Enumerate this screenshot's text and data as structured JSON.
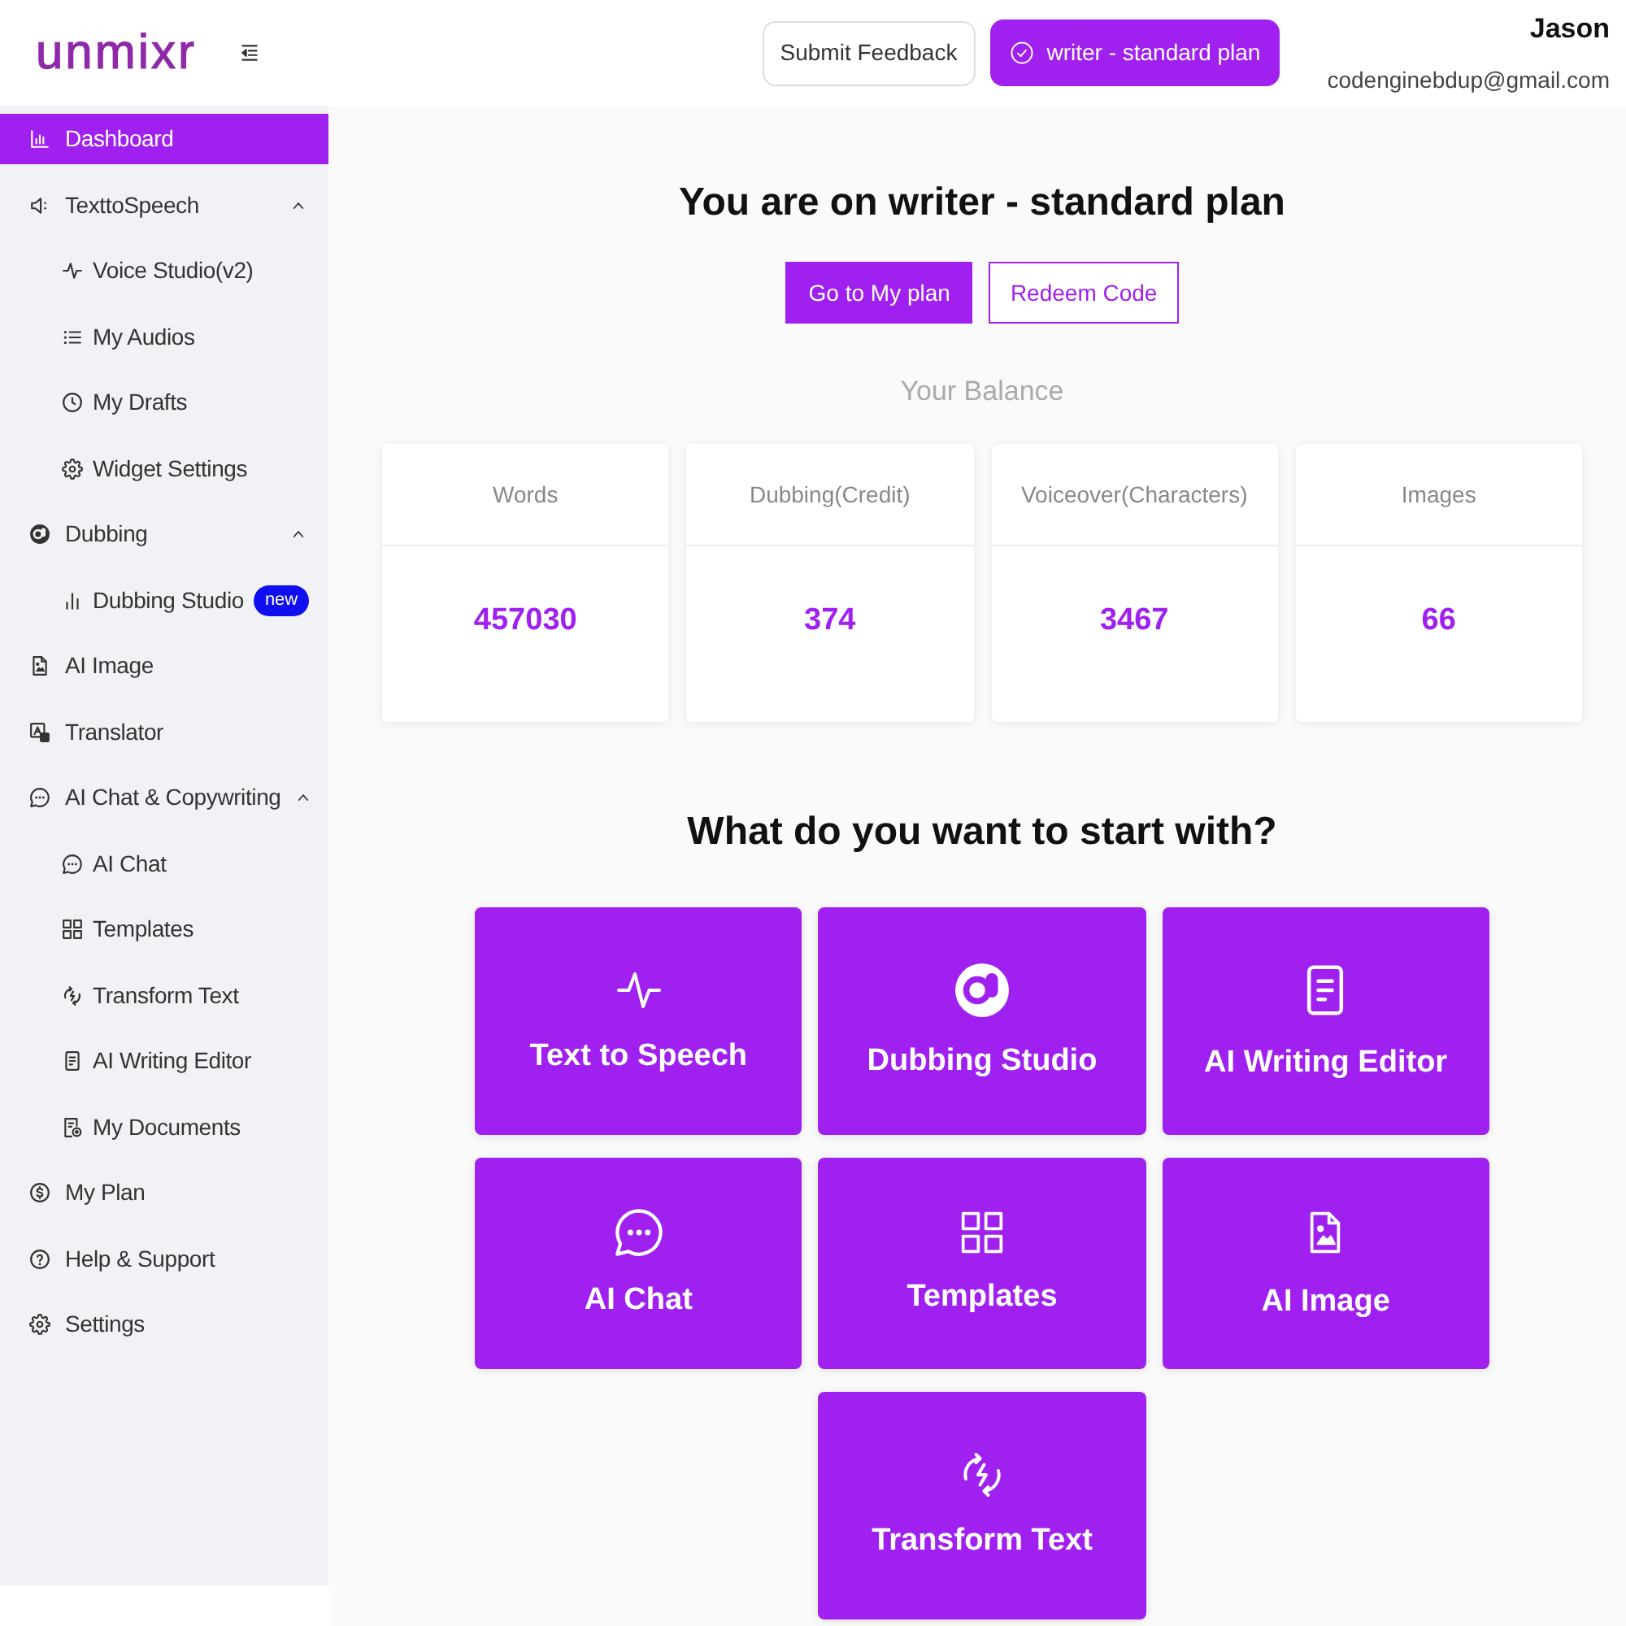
{
  "header": {
    "logo": "unmixr",
    "buttons": [
      {
        "kind": "outline",
        "label": "Submit Feedback"
      },
      {
        "kind": "plan",
        "label": "writer - standard plan"
      }
    ],
    "user": {
      "name": "Jason",
      "email": "codenginebdup@gmail.com"
    }
  },
  "sidebar": {
    "items": [
      {
        "label": "Dashboard",
        "selected": true
      },
      {
        "label": "TexttoSpeech",
        "selected": false,
        "expanded": true,
        "children": [
          {
            "label": "Voice Studio(v2)",
            "selected": false
          },
          {
            "label": "My Audios",
            "selected": false
          },
          {
            "label": "My Drafts",
            "selected": false
          },
          {
            "label": "Widget Settings",
            "selected": false
          }
        ]
      },
      {
        "label": "Dubbing",
        "selected": false,
        "expanded": true,
        "children": [
          {
            "label": "Dubbing Studio",
            "selected": false,
            "badge": "new"
          }
        ]
      },
      {
        "label": "AI Image",
        "selected": false
      },
      {
        "label": "Translator",
        "selected": false
      },
      {
        "label": "AI Chat & Copywriting",
        "selected": false,
        "expanded": true,
        "children": [
          {
            "label": "AI Chat",
            "selected": false
          },
          {
            "label": "Templates",
            "selected": false
          },
          {
            "label": "Transform Text",
            "selected": false
          },
          {
            "label": "AI Writing Editor",
            "selected": false
          },
          {
            "label": "My Documents",
            "selected": false
          }
        ]
      },
      {
        "label": "My Plan",
        "selected": false
      },
      {
        "label": "Help & Support",
        "selected": false
      },
      {
        "label": "Settings",
        "selected": false
      }
    ]
  },
  "plan_banner": {
    "title": "You are on writer - standard plan",
    "buttons": [
      {
        "kind": "filled",
        "label": "Go to My plan"
      },
      {
        "kind": "outline",
        "label": "Redeem Code"
      }
    ]
  },
  "balance": {
    "title": "Your Balance",
    "cards": [
      {
        "label": "Words",
        "value": "457030"
      },
      {
        "label": "Dubbing(Credit)",
        "value": "374"
      },
      {
        "label": "Voiceover(Characters)",
        "value": "3467"
      },
      {
        "label": "Images",
        "value": "66"
      }
    ]
  },
  "start": {
    "title": "What do you want to start with?",
    "tiles": [
      {
        "label": "Text to Speech"
      },
      {
        "label": "Dubbing Studio"
      },
      {
        "label": "AI Writing Editor"
      },
      {
        "label": "AI Chat"
      },
      {
        "label": "Templates"
      },
      {
        "label": "AI Image"
      },
      {
        "label": "Transform Text"
      }
    ]
  }
}
